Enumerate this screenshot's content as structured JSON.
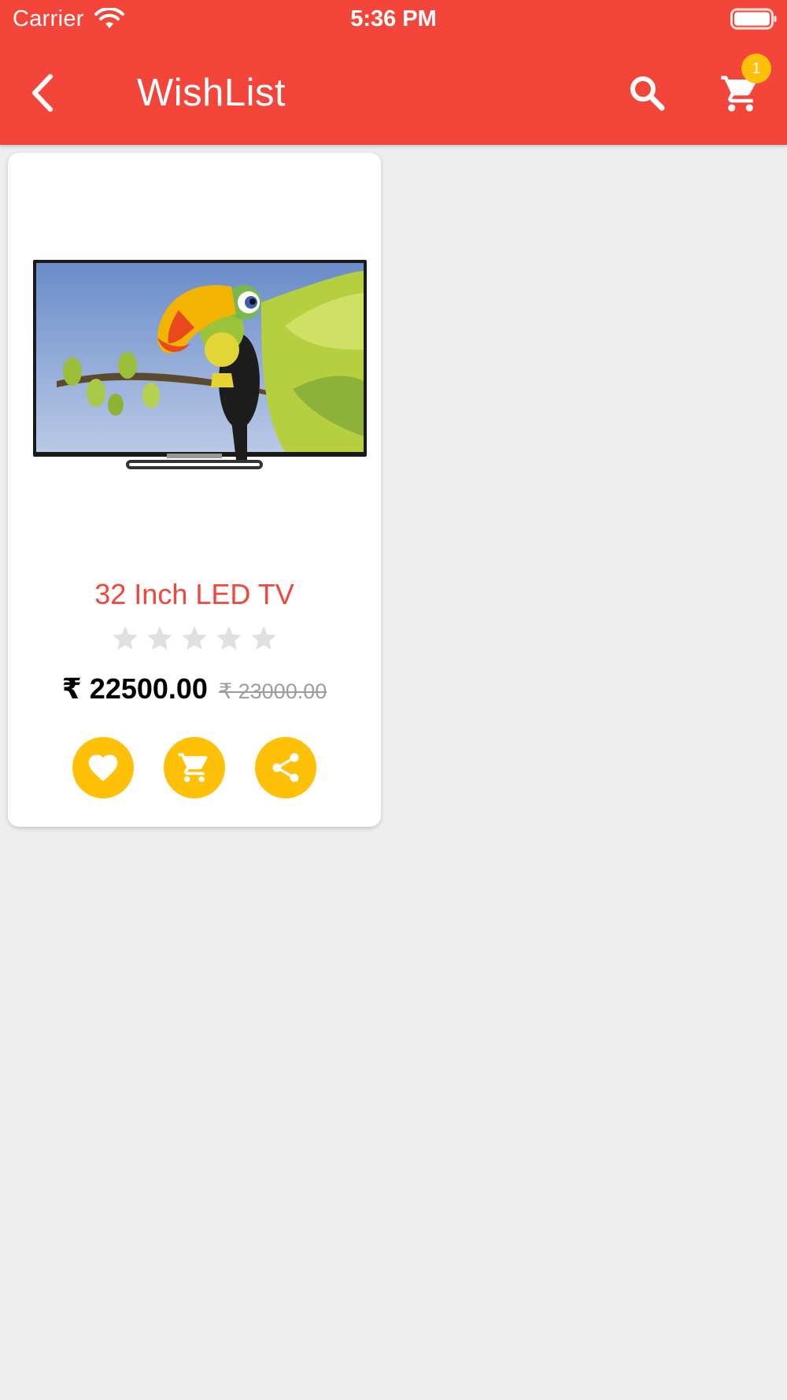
{
  "status_bar": {
    "carrier": "Carrier",
    "time": "5:36 PM"
  },
  "toolbar": {
    "title": "WishList",
    "cart_badge_count": "1",
    "icons": [
      "back-arrow-icon",
      "search-icon",
      "cart-icon"
    ]
  },
  "product": {
    "name": "32 Inch LED TV",
    "price": "₹ 22500.00",
    "original_price": "₹ 23000.00",
    "rating_value": 0,
    "rating_max": 5,
    "actions": [
      "heart-icon",
      "cart-icon",
      "share-icon"
    ]
  },
  "colors": {
    "primary": "#f4453a",
    "accent": "#ffc107",
    "background": "#eeeeee",
    "star_empty": "#e0e0e0"
  }
}
